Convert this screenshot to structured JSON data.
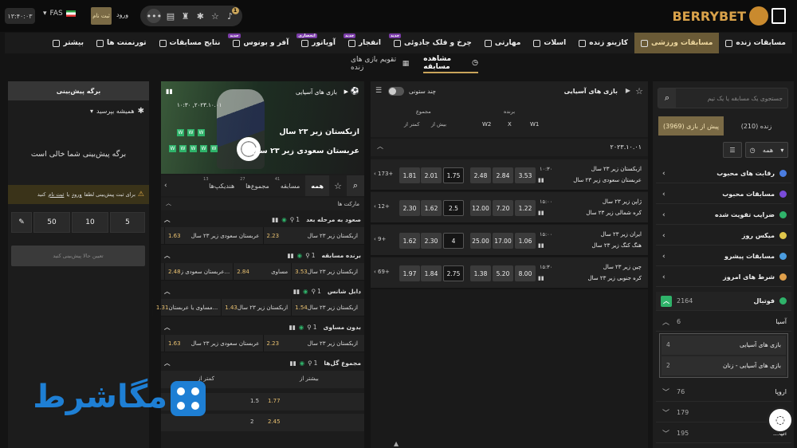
{
  "header": {
    "brand": "BERRYBET",
    "clock": "۱۳:۴۰:۰۳",
    "lang": "FAS",
    "signup": "ثبت نام",
    "login": "ورود",
    "notif_count": "1"
  },
  "nav": {
    "items": [
      {
        "label": "مسابقات زنده",
        "active": false
      },
      {
        "label": "مسابقات ورزشی",
        "active": true
      },
      {
        "label": "کازینو زنده",
        "active": false
      },
      {
        "label": "اسلات",
        "active": false
      },
      {
        "label": "مهارتی",
        "active": false
      },
      {
        "label": "چرخ و فلک جادوئی",
        "tag": "جدید",
        "active": false
      },
      {
        "label": "انفجار",
        "tag": "جدید",
        "active": false
      },
      {
        "label": "آویاتور",
        "tag": "انحصاری",
        "active": false
      },
      {
        "label": "آفر و بونوس",
        "tag": "جدید",
        "active": false
      },
      {
        "label": "نتایج مسابقات",
        "active": false
      },
      {
        "label": "تورنمنت ها",
        "active": false
      },
      {
        "label": "بیشتر",
        "active": false
      }
    ]
  },
  "subnav": {
    "watch": "مشاهده مسابقه",
    "calendar": "تقویم بازی های زنده"
  },
  "sidebar": {
    "search_placeholder": "جستجوی یک مسابقه یا یک تیم",
    "tab_live": "زنده (210)",
    "tab_pre": "پیش از بازی (3969)",
    "filter_all": "همه",
    "items": [
      {
        "label": "رقابت های محبوب"
      },
      {
        "label": "مسابقات محبوب"
      },
      {
        "label": "ضرایب تقویت شده"
      },
      {
        "label": "میکس روز"
      },
      {
        "label": "مسابقات پیشرو"
      },
      {
        "label": "شرط های امروز"
      }
    ],
    "sport": {
      "label": "فوتبال",
      "count": "2164"
    },
    "region": {
      "label": "آسیا",
      "count": "6"
    },
    "leagues": [
      {
        "label": "بازی های آسیایی",
        "count": "4"
      },
      {
        "label": "بازی های آسیایی - زنان",
        "count": "2"
      }
    ],
    "more_regions": [
      {
        "label": "اروپا",
        "count": "76"
      },
      {
        "label": "...س",
        "count": "179"
      },
      {
        "label": "...الیا",
        "count": "195"
      }
    ]
  },
  "matches": {
    "league": "بازی های آسیایی",
    "multi_col": "چند ستونی",
    "headers": {
      "winner": "برنده",
      "w1": "W1",
      "x": "X",
      "w2": "W2",
      "total": "مجموع",
      "over": "بیش از",
      "under": "کمتر از"
    },
    "date": "۲۰۲۳.۱۰.۰۱",
    "rows": [
      {
        "home": "ازبکستان زیر ۲۳ سال",
        "away": "عربستان سعودی زیر ۲۳ سال",
        "time": "۱۰:۳۰",
        "w1": "3.53",
        "x": "2.84",
        "w2": "2.48",
        "line": "1.75",
        "over": "2.01",
        "under": "1.81",
        "more": "173+"
      },
      {
        "home": "ژاپن زیر ۲۳ سال",
        "away": "کره شمالی زیر ۲۳ سال",
        "time": "۱۵:۰۰",
        "w1": "1.22",
        "x": "7.20",
        "w2": "12.00",
        "line": "2.5",
        "over": "1.62",
        "under": "2.30",
        "more": "12+"
      },
      {
        "home": "ایران زیر ۲۳ سال",
        "away": "هنگ کنگ زیر ۲۳ سال",
        "time": "۱۵:۰۰",
        "w1": "1.06",
        "x": "17.00",
        "w2": "25.00",
        "line": "4",
        "over": "2.30",
        "under": "1.62",
        "more": "9+"
      },
      {
        "home": "چین زیر ۲۳ سال",
        "away": "کره جنوبی زیر ۲۳ سال",
        "time": "۱۵:۳۰",
        "w1": "8.00",
        "x": "5.20",
        "w2": "1.38",
        "line": "2.75",
        "over": "1.84",
        "under": "1.97",
        "more": "69+"
      }
    ]
  },
  "market": {
    "league": "بازی های آسیایی",
    "date": "۱۰:۳۰ ,۲۰۲۳.۱۰.۰۱",
    "home": "ازبکستان زیر ۲۳ سال",
    "away": "عربستان سعودی زیر ۲۳ سال",
    "tabs": [
      {
        "label": "همه"
      },
      {
        "label": "مسابقه",
        "count": "41"
      },
      {
        "label": "مجموع‌ها",
        "count": "27"
      },
      {
        "label": "هندیکپ‌ها",
        "count": "13"
      }
    ],
    "section": "مارکت ها",
    "groups": [
      {
        "title": "صعود به مرحله بعد",
        "count": "1",
        "cells": [
          "ازبکستان زیر ۲۳ سال",
          "2.23",
          "عربستان سعودی زیر ۲۳ سال",
          "1.63"
        ]
      },
      {
        "title": "برنده مسابقه",
        "count": "1",
        "cells": [
          "ازبکستان زیر ۲۳ سال",
          "3.53",
          "مساوی",
          "2.84",
          "عربستان سعودی ز...",
          "2.48"
        ]
      },
      {
        "title": "دابل شانس",
        "count": "1",
        "cells": [
          "ازبکستان زیر ۲۳ سال",
          "1.54",
          "ازبکستان زیر ۲۳ سال",
          "1.43",
          "مساوی یا عربستان...",
          "1.31"
        ]
      },
      {
        "title": "بدون مساوی",
        "count": "1",
        "cells": [
          "ازبکستان زیر ۲۳ سال",
          "2.23",
          "عربستان سعودی زیر ۲۳ سال",
          "1.63"
        ]
      },
      {
        "title": "مجموع گل‌ها",
        "count": "1"
      }
    ],
    "totals_head": {
      "over": "بیشتر از",
      "under": "کمتر از"
    },
    "totals": [
      {
        "line": "1.5",
        "over": "1.77"
      },
      {
        "line": "2",
        "over": "2.45"
      }
    ]
  },
  "slip": {
    "title": "برگه پیش‌بینی",
    "option": "همیشه بپرسید",
    "empty": "برگه پیش‌بینی شما خالی است",
    "notice_pre": "برای ثبت پیش‌بینی لطفا",
    "notice_login": "ورود",
    "notice_or": "یا",
    "notice_signup": "ثبت نام",
    "notice_post": "کنید",
    "stakes": [
      "5",
      "10",
      "50"
    ],
    "submit": "تعیین حالا پیش‌بینی کنید"
  },
  "watermark": "مگاشرط"
}
